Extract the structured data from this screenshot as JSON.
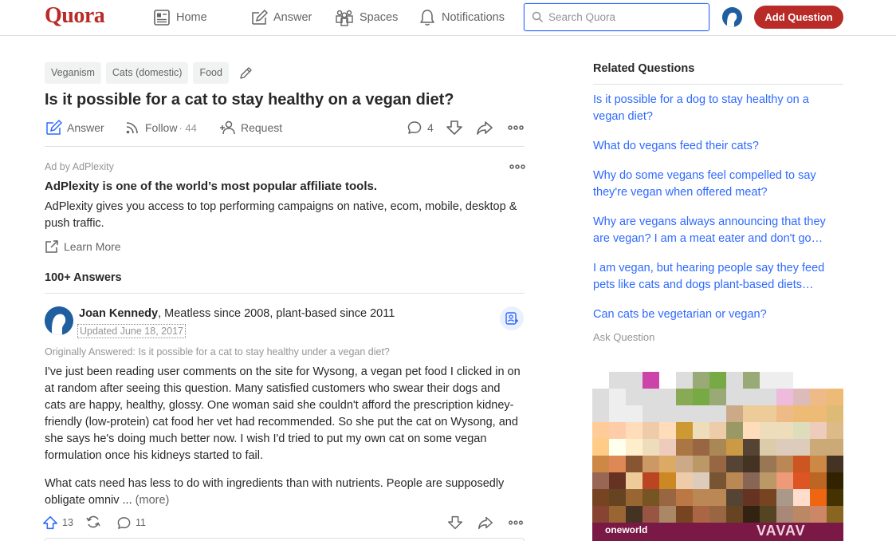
{
  "header": {
    "logo": "Quora",
    "nav": [
      {
        "label": "Home",
        "icon": "home-icon"
      },
      {
        "label": "Answer",
        "icon": "pencil-square-icon"
      },
      {
        "label": "Spaces",
        "icon": "people-icon"
      },
      {
        "label": "Notifications",
        "icon": "bell-icon"
      }
    ],
    "search_placeholder": "Search Quora",
    "add_question_label": "Add Question"
  },
  "question": {
    "topics": [
      "Veganism",
      "Cats (domestic)",
      "Food"
    ],
    "title": "Is it possible for a cat to stay healthy on a vegan diet?",
    "actions": {
      "answer_label": "Answer",
      "follow_label": "Follow",
      "follow_count": "· 44",
      "request_label": "Request",
      "comment_count": "4"
    }
  },
  "ad": {
    "label": "Ad by AdPlexity",
    "title": "AdPlexity is one of the world’s most popular affiliate tools.",
    "body": "AdPlexity gives you access to top performing campaigns on native, ecom, mobile, desktop & push traffic.",
    "cta": "Learn More"
  },
  "answers_header": "100+ Answers",
  "answer": {
    "author": "Joan Kennedy",
    "credential": ", Meatless since 2008, plant-based since 2011",
    "updated": "Updated June 18, 2017",
    "originally_answered": "Originally Answered: Is it possible for a cat to stay healthy under a vegan diet?",
    "paragraph1": "I've just been reading user comments on the site for Wysong, a vegan pet food I clicked in on at random after seeing this question. Many satisfied customers who swear their dogs and cats are happy, healthy, glossy. One woman said she couldn't afford the prescription kidney-friendly (low-protein) cat food her vet had recommended. So she put the cat on Wysong, and she says he's doing much better now. I wish I'd tried to put my own cat on some vegan formulation once his kidneys started to fail.",
    "paragraph2": "What cats need has less to do with ingredients than with nutrients. People are supposedly obligate omniv ... ",
    "more_label": "(more)",
    "upvotes": "13",
    "comments": "11"
  },
  "sidebar": {
    "title": "Related Questions",
    "questions": [
      "Is it possible for a dog to stay healthy on a vegan diet?",
      "What do vegans feed their cats?",
      "Why do some vegans feel compelled to say they're vegan when offered meat?",
      "Why are vegans always announcing that they are vegan? I am a meat eater and don't go…",
      "I am vegan, but hearing people say they feed pets like cats and dogs plant-based diets…",
      "Can cats be vegetarian or vegan?"
    ],
    "ask_question": "Ask Question",
    "ad_strip_left": "oneworld",
    "ad_strip_right": "VAVAV"
  },
  "colors": {
    "brand": "#b92b27",
    "link": "#2e69ff",
    "muted": "#636466",
    "faint": "#939598"
  }
}
